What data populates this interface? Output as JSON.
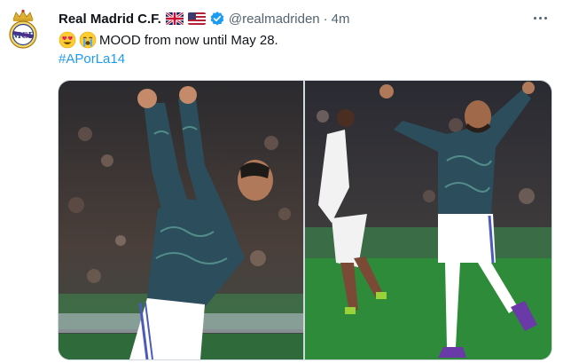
{
  "account": {
    "display_name": "Real Madrid C.F.",
    "handle": "@realmadriden",
    "separator": "·",
    "timestamp": "4m",
    "flags": [
      "uk-flag-icon",
      "us-flag-icon"
    ],
    "verified_icon": "verified-badge-icon",
    "avatar_icon": "real-madrid-crest-icon"
  },
  "tweet": {
    "emojis": [
      "heart-eyes-emoji",
      "crying-face-emoji"
    ],
    "text": "MOOD from now until May 28.",
    "hashtag": "#APorLa14"
  },
  "menu": {
    "icon": "more-options-icon"
  },
  "media": [
    {
      "name": "player-celebrating-fists-raised-photo"
    },
    {
      "name": "player-celebrating-arms-wide-photo"
    }
  ],
  "colors": {
    "link": "#1d9bf0",
    "secondary_text": "#536471",
    "verified": "#1d9bf0",
    "jacket": "#2b4d5c",
    "shorts": "#ffffff",
    "pitch": "#2e8b3a"
  }
}
